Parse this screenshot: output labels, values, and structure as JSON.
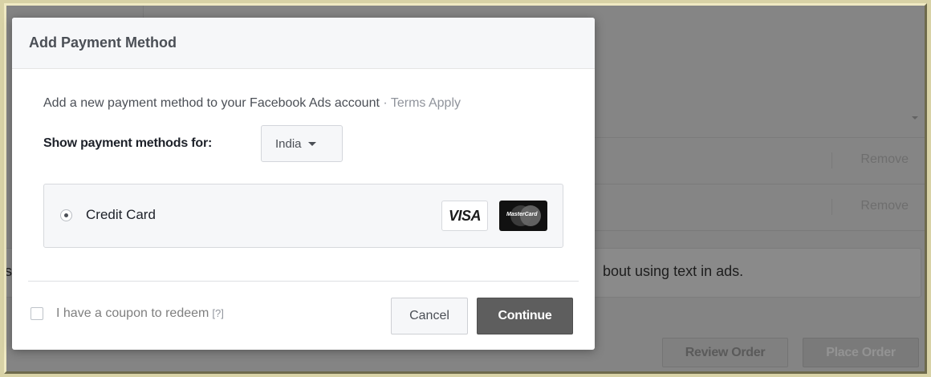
{
  "background": {
    "rows": [
      {
        "action": "Remove"
      },
      {
        "action": "Remove"
      }
    ],
    "notice_edge": "s",
    "notice_text": "bout using text in ads.",
    "review_label": "Review Order",
    "place_label": "Place Order"
  },
  "dialog": {
    "title": "Add Payment Method",
    "intro": "Add a new payment method to your Facebook Ads account",
    "intro_sep": " · ",
    "terms": "Terms Apply",
    "country_label": "Show payment methods for:",
    "country_value": "India",
    "method_label": "Credit Card",
    "visa_text": "VISA",
    "mastercard_text": "MasterCard",
    "coupon_label": "I have a coupon to redeem",
    "coupon_help": "[?]",
    "cancel_label": "Cancel",
    "continue_label": "Continue"
  },
  "colors": {
    "continue_bg": "#5e5e5e",
    "overlay": "#848484",
    "outer_frame": "#d8d2a6"
  }
}
